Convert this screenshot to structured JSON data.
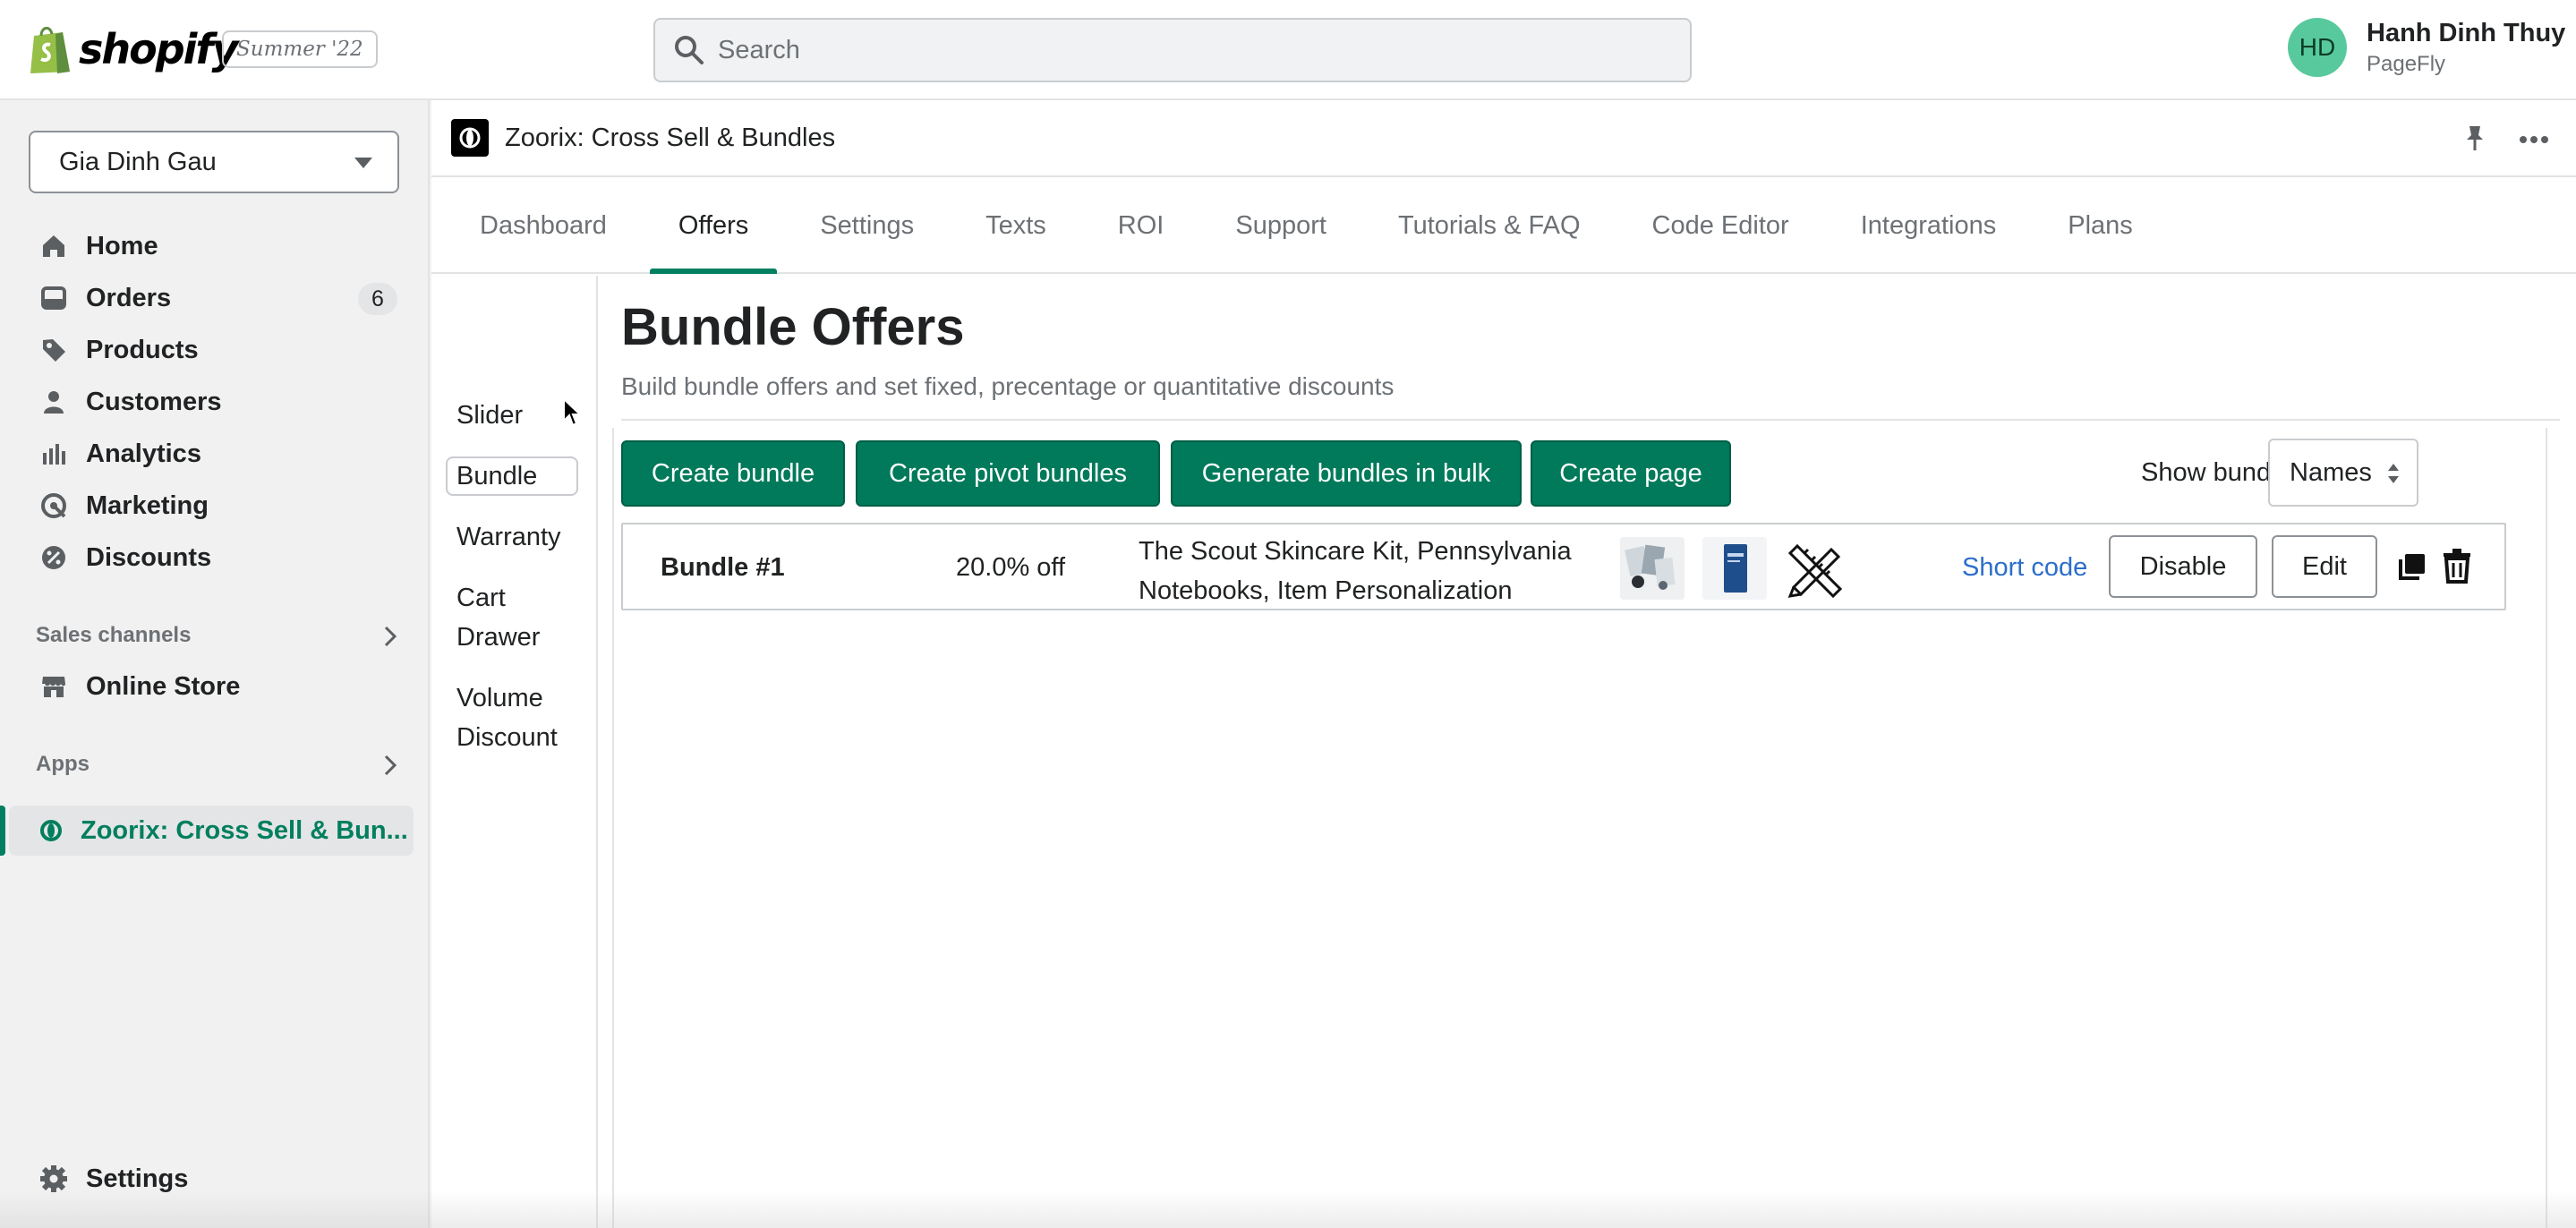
{
  "topbar": {
    "brand": "shopify",
    "season": "Summer '22",
    "search_placeholder": "Search",
    "user_initials": "HD",
    "user_name": "Hanh Dinh Thuy",
    "user_store": "PageFly",
    "avatar_color": "#58c99c"
  },
  "sidebar": {
    "store": "Gia Dinh Gau",
    "items": [
      {
        "label": "Home",
        "icon": "home-icon"
      },
      {
        "label": "Orders",
        "icon": "orders-icon",
        "count": "6"
      },
      {
        "label": "Products",
        "icon": "tag-icon"
      },
      {
        "label": "Customers",
        "icon": "person-icon"
      },
      {
        "label": "Analytics",
        "icon": "analytics-icon"
      },
      {
        "label": "Marketing",
        "icon": "marketing-icon"
      },
      {
        "label": "Discounts",
        "icon": "discount-icon"
      }
    ],
    "sales_channels_label": "Sales channels",
    "online_store": "Online Store",
    "apps_label": "Apps",
    "active_app": "Zoorix: Cross Sell & Bun...",
    "settings": "Settings",
    "accent_color": "#008060"
  },
  "app": {
    "title": "Zoorix: Cross Sell & Bundles",
    "tabs": [
      "Dashboard",
      "Offers",
      "Settings",
      "Texts",
      "ROI",
      "Support",
      "Tutorials & FAQ",
      "Code Editor",
      "Integrations",
      "Plans"
    ],
    "active_tab": "Offers",
    "subnav": [
      "Slider",
      "Bundle",
      "Warranty",
      "Cart Drawer",
      "Volume Discount"
    ],
    "active_subnav": "Bundle",
    "page_title": "Bundle Offers",
    "page_subtitle": "Build bundle offers and set fixed, precentage or quantitative discounts",
    "buttons": [
      "Create bundle",
      "Create pivot bundles",
      "Generate bundles in bulk",
      "Create page"
    ],
    "show_by_label": "Show bundles by:",
    "show_by_value": "Names",
    "bundles": [
      {
        "name": "Bundle #1",
        "discount": "20.0% off",
        "products": "The Scout Skincare Kit, Pennsylvania Notebooks, Item Personalization",
        "short_code": "Short code",
        "disable": "Disable",
        "edit": "Edit"
      }
    ],
    "button_color": "#007a5a",
    "link_color": "#2c6ecb"
  }
}
